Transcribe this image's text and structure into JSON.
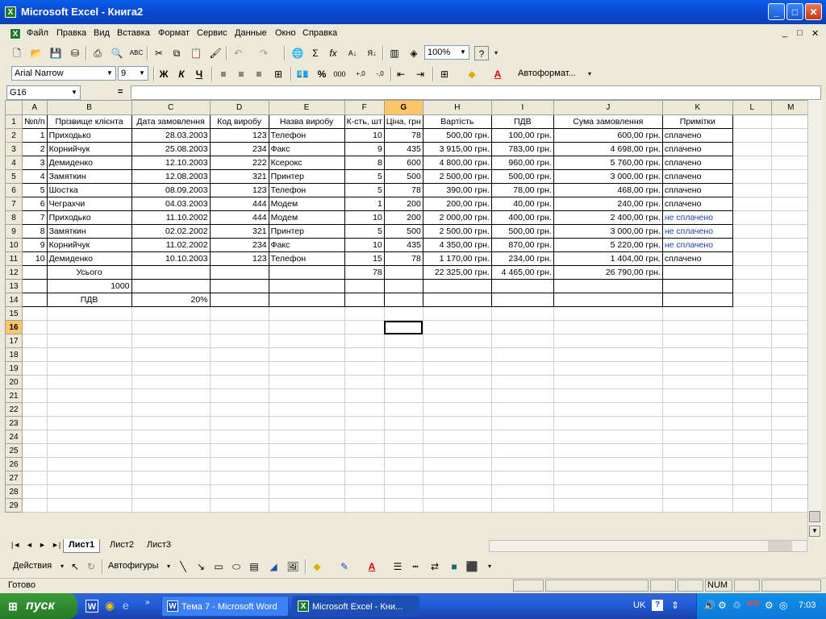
{
  "window": {
    "title": "Microsoft Excel - Книга2",
    "min": "_",
    "max": "□",
    "close": "✕"
  },
  "menu": {
    "items": [
      "Файл",
      "Правка",
      "Вид",
      "Вставка",
      "Формат",
      "Сервис",
      "Данные",
      "Окно",
      "Справка"
    ],
    "doc_controls": [
      "_",
      "□",
      "✕"
    ]
  },
  "toolbar": {
    "zoom": "100%",
    "help": "?",
    "autosum": "Σ",
    "fx": "fx",
    "font_name": "Arial Narrow",
    "font_size": "9",
    "bold": "Ж",
    "italic": "К",
    "underline": "Ч",
    "percent": "%",
    "thousands": "000",
    "inc_dec": ",0→,00",
    "dec_dec": ",00→,0",
    "autoformat": "Автоформат..."
  },
  "formula": {
    "name_box": "G16",
    "equals": "=",
    "content": ""
  },
  "sheet": {
    "columns": [
      "A",
      "B",
      "C",
      "D",
      "E",
      "F",
      "G",
      "H",
      "I",
      "J",
      "K",
      "L",
      "M"
    ],
    "selected_column": "G",
    "selected_row": 16,
    "headers": [
      "№п/п",
      "Прізвище клієнта",
      "Дата замовлення",
      "Код виробу",
      "Назва виробу",
      "К-сть, шт",
      "Ціна, грн",
      "Вартість",
      "ПДВ",
      "Сума замовлення",
      "Примітки"
    ],
    "rows": [
      [
        "1",
        "Приходько",
        "28.03.2003",
        "123",
        "Телефон",
        "10",
        "78",
        "500,00 грн.",
        "100,00 грн.",
        "600,00 грн.",
        "сплачено"
      ],
      [
        "2",
        "Корнийчук",
        "25.08.2003",
        "234",
        "Факс",
        "9",
        "435",
        "3 915,00 грн.",
        "783,00 грн.",
        "4 698,00 грн.",
        "сплачено"
      ],
      [
        "3",
        "Демиденко",
        "12.10.2003",
        "222",
        "Ксерокс",
        "8",
        "600",
        "4 800,00 грн.",
        "960,00 грн.",
        "5 760,00 грн.",
        "сплачено"
      ],
      [
        "4",
        "Замяткин",
        "12.08.2003",
        "321",
        "Принтер",
        "5",
        "500",
        "2 500,00 грн.",
        "500,00 грн.",
        "3 000,00 грн.",
        "сплачено"
      ],
      [
        "5",
        "Шостка",
        "08.09.2003",
        "123",
        "Телефон",
        "5",
        "78",
        "390,00 грн.",
        "78,00 грн.",
        "468,00 грн.",
        "сплачено"
      ],
      [
        "6",
        "Чеграхчи",
        "04.03.2003",
        "444",
        "Модем",
        "1",
        "200",
        "200,00 грн.",
        "40,00 грн.",
        "240,00 грн.",
        "сплачено"
      ],
      [
        "7",
        "Приходько",
        "11.10.2002",
        "444",
        "Модем",
        "10",
        "200",
        "2 000,00 грн.",
        "400,00 грн.",
        "2 400,00 грн.",
        "не сплачено"
      ],
      [
        "8",
        "Замяткин",
        "02.02.2002",
        "321",
        "Принтер",
        "5",
        "500",
        "2 500,00 грн.",
        "500,00 грн.",
        "3 000,00 грн.",
        "не сплачено"
      ],
      [
        "9",
        "Корнийчук",
        "11.02.2002",
        "234",
        "Факс",
        "10",
        "435",
        "4 350,00 грн.",
        "870,00 грн.",
        "5 220,00 грн.",
        "не сплачено"
      ],
      [
        "10",
        "Демиденко",
        "10.10.2003",
        "123",
        "Телефон",
        "15",
        "78",
        "1 170,00 грн.",
        "234,00 грн.",
        "1 404,00 грн.",
        "сплачено"
      ]
    ],
    "total_label": "Усього",
    "total_qty": "78",
    "total_cost": "22 325,00 грн.",
    "total_vat": "4 465,00 грн.",
    "total_sum": "26 790,00 грн.",
    "row13_value": "1000",
    "vat_label": "ПДВ",
    "vat_rate": "20%",
    "row_count": 29
  },
  "tabs": {
    "nav": [
      "|◄",
      "◄",
      "►",
      "►|"
    ],
    "sheets": [
      "Лист1",
      "Лист2",
      "Лист3"
    ],
    "active": 0
  },
  "drawing": {
    "actions": "Действия",
    "autoshapes": "Автофигуры"
  },
  "status": {
    "ready": "Готово",
    "num": "NUM"
  },
  "taskbar": {
    "start": "пуск",
    "tasks": [
      "Тема 7 - Microsoft Word",
      "Microsoft Excel - Кни..."
    ],
    "lang": "UK",
    "clock": "7:03"
  },
  "colors": {
    "title_blue": "#0b4cd4",
    "selection": "#ffc669",
    "unpaid_text": "#1f3fa6",
    "start_green": "#2f8b2f"
  }
}
